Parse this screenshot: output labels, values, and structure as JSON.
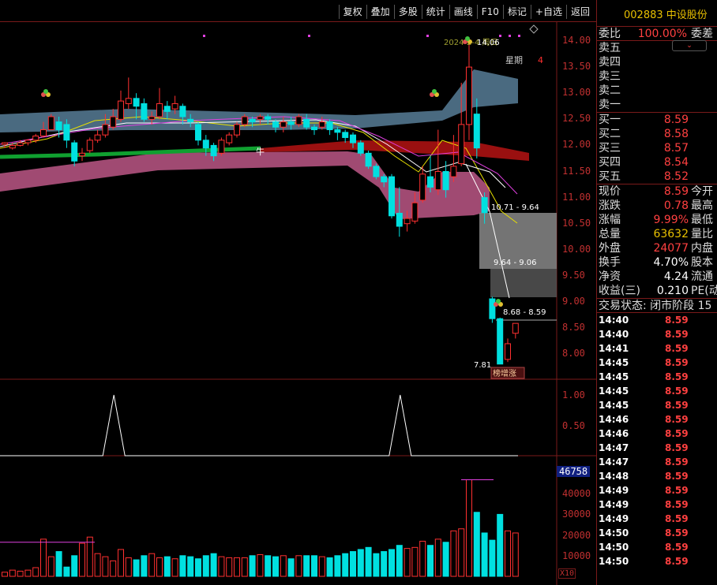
{
  "toolbar": {
    "items": [
      "复权",
      "叠加",
      "多股",
      "统计",
      "画线",
      "F10",
      "标记",
      "+自选",
      "返回"
    ]
  },
  "stock": {
    "code": "002883",
    "name": "中设股份"
  },
  "orderbook": {
    "ratio_label": "委比",
    "ratio_value": "100.00%",
    "ratio_right": "委差",
    "asks": [
      {
        "label": "卖五",
        "price": ""
      },
      {
        "label": "卖四",
        "price": ""
      },
      {
        "label": "卖三",
        "price": ""
      },
      {
        "label": "卖二",
        "price": ""
      },
      {
        "label": "卖一",
        "price": ""
      }
    ],
    "bids": [
      {
        "label": "买一",
        "price": "8.59"
      },
      {
        "label": "买二",
        "price": "8.58"
      },
      {
        "label": "买三",
        "price": "8.57"
      },
      {
        "label": "买四",
        "price": "8.54"
      },
      {
        "label": "买五",
        "price": "8.52"
      }
    ]
  },
  "quote": [
    {
      "label": "现价",
      "value": "8.59",
      "right": "今开",
      "color": "#ff4040"
    },
    {
      "label": "涨跌",
      "value": "0.78",
      "right": "最高",
      "color": "#ff4040"
    },
    {
      "label": "涨幅",
      "value": "9.99%",
      "right": "最低",
      "color": "#ff4040"
    },
    {
      "label": "总量",
      "value": "63632",
      "right": "量比",
      "color": "#e8c000"
    },
    {
      "label": "外盘",
      "value": "24077",
      "right": "内盘",
      "color": "#ff4040"
    },
    {
      "label": "换手",
      "value": "4.70%",
      "right": "股本",
      "color": "#ffffff"
    },
    {
      "label": "净资",
      "value": "4.24",
      "right": "流通",
      "color": "#ffffff"
    },
    {
      "label": "收益(三)",
      "value": "0.210",
      "right": "PE(动",
      "color": "#ffffff"
    }
  ],
  "trade_status": "交易状态: 闭市阶段 15",
  "ticks": [
    {
      "time": "14:40",
      "price": "8.59"
    },
    {
      "time": "14:40",
      "price": "8.59"
    },
    {
      "time": "14:41",
      "price": "8.59"
    },
    {
      "time": "14:45",
      "price": "8.59"
    },
    {
      "time": "14:45",
      "price": "8.59"
    },
    {
      "time": "14:45",
      "price": "8.59"
    },
    {
      "time": "14:45",
      "price": "8.59"
    },
    {
      "time": "14:46",
      "price": "8.59"
    },
    {
      "time": "14:46",
      "price": "8.59"
    },
    {
      "time": "14:47",
      "price": "8.59"
    },
    {
      "time": "14:47",
      "price": "8.59"
    },
    {
      "time": "14:48",
      "price": "8.59"
    },
    {
      "time": "14:49",
      "price": "8.59"
    },
    {
      "time": "14:49",
      "price": "8.59"
    },
    {
      "time": "14:49",
      "price": "8.59"
    },
    {
      "time": "14:50",
      "price": "8.59"
    },
    {
      "time": "14:50",
      "price": "8.59"
    },
    {
      "time": "14:50",
      "price": "8.59"
    }
  ],
  "main_axis": [
    "14.00",
    "13.50",
    "13.00",
    "12.50",
    "12.00",
    "11.50",
    "11.00",
    "10.50",
    "10.00",
    "9.50",
    "9.00",
    "8.50",
    "8.00"
  ],
  "ind_axis": [
    "1.00",
    "0.50"
  ],
  "vol_axis": [
    "40000",
    "30000",
    "20000",
    "10000"
  ],
  "vol_current": "46758",
  "vol_unit": "X10",
  "annotations": {
    "date_label": "2024-2-4 周日",
    "weekday": "星期",
    "weekday_num": "4",
    "peak": "14.06",
    "gap1": "10.71 - 9.64",
    "gap2": "9.64 - 9.06",
    "gap3": "8.68 - 8.59",
    "low": "7.81",
    "tag": "榜增涨",
    "cow": "牛"
  },
  "colors": {
    "up": "#ff3030",
    "down": "#00e0e0",
    "band_top": "#4a6a80",
    "band_mid": "#9a1010",
    "band_low": "#a04a72",
    "green": "#10a030"
  },
  "chart_data": {
    "type": "candlestick",
    "ylim": [
      7.6,
      14.3
    ],
    "candles": [
      [
        12.02,
        12.05,
        11.95,
        12.06
      ],
      [
        11.95,
        12.0,
        11.92,
        12.05
      ],
      [
        12.0,
        12.05,
        11.98,
        12.1
      ],
      [
        12.05,
        12.1,
        12.0,
        12.12
      ],
      [
        12.1,
        12.18,
        12.05,
        12.22
      ],
      [
        12.18,
        12.3,
        12.15,
        12.45
      ],
      [
        12.3,
        12.55,
        12.3,
        12.6
      ],
      [
        12.45,
        12.3,
        12.15,
        12.55
      ],
      [
        12.4,
        12.1,
        11.95,
        12.5
      ],
      [
        12.05,
        11.7,
        11.6,
        12.1
      ],
      [
        11.8,
        11.85,
        11.7,
        11.95
      ],
      [
        11.9,
        12.1,
        11.85,
        12.15
      ],
      [
        12.1,
        12.2,
        12.05,
        12.3
      ],
      [
        12.2,
        12.4,
        12.15,
        12.6
      ],
      [
        12.35,
        12.55,
        12.3,
        12.7
      ],
      [
        12.5,
        12.85,
        12.45,
        13.05
      ],
      [
        12.8,
        12.9,
        12.7,
        13.3
      ],
      [
        12.9,
        12.75,
        12.5,
        13.0
      ],
      [
        12.8,
        12.5,
        12.45,
        12.9
      ],
      [
        12.5,
        12.55,
        12.4,
        12.65
      ],
      [
        12.55,
        12.8,
        12.5,
        13.1
      ],
      [
        12.75,
        12.65,
        12.5,
        12.85
      ],
      [
        12.7,
        12.8,
        12.6,
        12.95
      ],
      [
        12.75,
        12.55,
        12.4,
        12.8
      ],
      [
        12.5,
        12.45,
        12.35,
        12.6
      ],
      [
        12.4,
        12.1,
        12.0,
        12.45
      ],
      [
        12.1,
        11.95,
        11.8,
        12.2
      ],
      [
        12.0,
        11.8,
        11.7,
        12.05
      ],
      [
        11.85,
        12.1,
        11.8,
        12.15
      ],
      [
        12.05,
        12.2,
        12.0,
        12.25
      ],
      [
        12.2,
        12.4,
        12.15,
        12.45
      ],
      [
        12.4,
        12.55,
        12.35,
        12.6
      ],
      [
        12.5,
        12.45,
        12.35,
        12.55
      ],
      [
        12.5,
        12.55,
        12.4,
        12.6
      ],
      [
        12.55,
        12.5,
        12.4,
        12.6
      ],
      [
        12.45,
        12.35,
        12.25,
        12.5
      ],
      [
        12.35,
        12.45,
        12.25,
        12.55
      ],
      [
        12.45,
        12.4,
        12.3,
        12.55
      ],
      [
        12.4,
        12.55,
        12.35,
        12.6
      ],
      [
        12.5,
        12.35,
        12.3,
        12.6
      ],
      [
        12.35,
        12.3,
        12.2,
        12.4
      ],
      [
        12.35,
        12.45,
        12.3,
        12.55
      ],
      [
        12.45,
        12.3,
        12.2,
        12.5
      ],
      [
        12.3,
        12.25,
        12.1,
        12.35
      ],
      [
        12.25,
        12.15,
        12.05,
        12.3
      ],
      [
        12.2,
        12.05,
        11.95,
        12.25
      ],
      [
        12.05,
        11.85,
        11.8,
        12.1
      ],
      [
        11.85,
        11.6,
        11.55,
        11.9
      ],
      [
        11.6,
        11.4,
        11.35,
        11.65
      ],
      [
        11.4,
        11.3,
        11.2,
        11.45
      ],
      [
        11.4,
        10.65,
        10.6,
        11.45
      ],
      [
        10.7,
        10.45,
        10.25,
        11.2
      ],
      [
        10.5,
        10.6,
        10.35,
        10.75
      ],
      [
        10.55,
        10.9,
        10.5,
        11.1
      ],
      [
        10.95,
        11.45,
        10.9,
        11.6
      ],
      [
        11.4,
        11.2,
        11.1,
        11.8
      ],
      [
        11.15,
        11.5,
        11.05,
        12.3
      ],
      [
        11.5,
        11.15,
        11.0,
        11.7
      ],
      [
        11.4,
        11.6,
        11.3,
        12.2
      ],
      [
        11.65,
        12.4,
        11.6,
        13.2
      ],
      [
        12.4,
        13.5,
        12.1,
        14.06
      ],
      [
        12.6,
        11.95,
        11.75,
        12.9
      ],
      [
        11.0,
        10.71,
        10.5,
        11.1
      ],
      [
        9.06,
        8.68,
        8.6,
        9.1
      ],
      [
        8.68,
        7.81,
        7.81,
        8.7
      ],
      [
        7.9,
        8.2,
        7.85,
        8.3
      ],
      [
        8.4,
        8.59,
        8.3,
        8.59
      ]
    ],
    "volume": [
      2000,
      3000,
      2500,
      3000,
      4200,
      18000,
      9500,
      12000,
      4500,
      10000,
      16000,
      19000,
      11000,
      9500,
      7500,
      13000,
      9000,
      8000,
      10000,
      11000,
      9000,
      9500,
      8500,
      10000,
      9500,
      8500,
      10000,
      11000,
      9500,
      9000,
      9000,
      9000,
      10000,
      10500,
      10000,
      9500,
      10000,
      8500,
      10000,
      10000,
      10000,
      9500,
      9000,
      10000,
      11000,
      12000,
      13000,
      14000,
      11000,
      12000,
      13000,
      15000,
      13500,
      14000,
      17000,
      15000,
      18000,
      16500,
      22000,
      23000,
      46758,
      31000,
      21000,
      17500,
      30000,
      22000,
      21000
    ],
    "indicator_peaks": [
      14,
      51
    ]
  }
}
